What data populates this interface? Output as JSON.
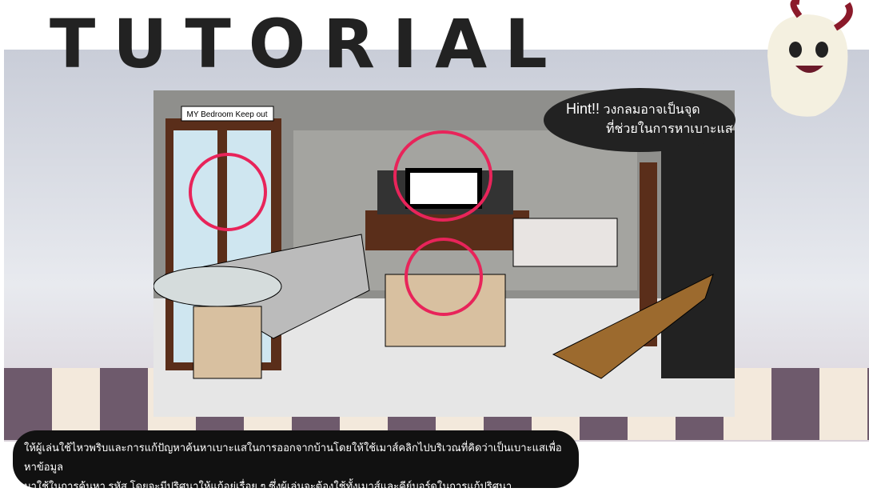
{
  "title": "TUTORIAL",
  "sign": "MY Bedroom Keep out",
  "hint": {
    "prefix": "Hint!!",
    "line1": "วงกลมอาจเป็นจุด",
    "line2": "ที่ช่วยในการหาเบาะแส"
  },
  "description": {
    "line1": "ให้ผู้เล่นใช้ไหวพริบและการแก้ปัญหาค้นหาเบาะแสในการออกจากบ้านโดยให้ใช้เมาส์คลิกไปบริเวณที่คิดว่าเป็นเบาะแสเพื่อหาข้อมูล",
    "line2": "มาใช้ในการค้นหา รหัส โดยจะมีปริศนาให้แก้อยู่เรื่อย ๆ ซึ่งผู้เล่นจะต้องใช้ทั้งเมาส์และคีย์บอร์ดในการแก้ปริศนา"
  },
  "colors": {
    "circle": "#e8245a"
  }
}
